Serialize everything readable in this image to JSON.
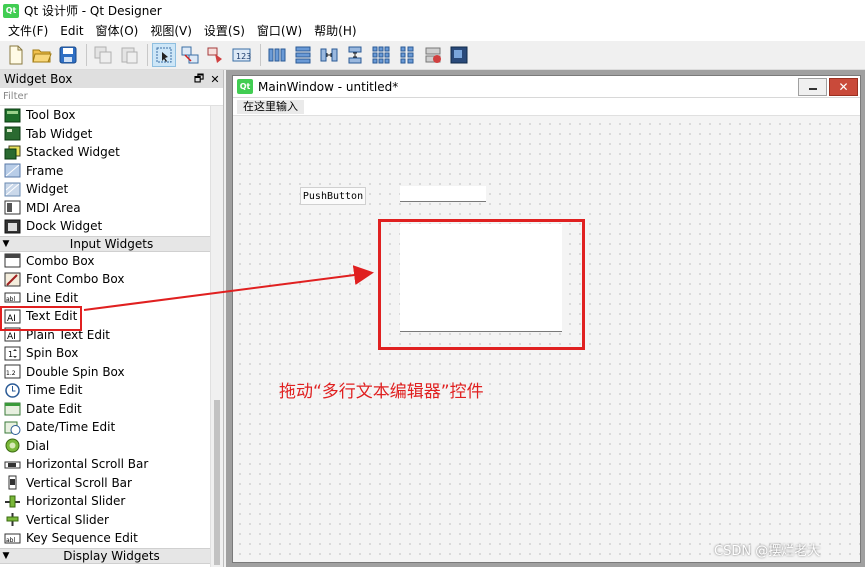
{
  "window": {
    "title": "Qt 设计师 - Qt Designer"
  },
  "menu": [
    "文件(F)",
    "Edit",
    "窗体(O)",
    "视图(V)",
    "设置(S)",
    "窗口(W)",
    "帮助(H)"
  ],
  "toolbar": [
    "new-icon",
    "open-icon",
    "save-icon",
    "copy-icon",
    "paste-icon",
    "edit-widgets-icon",
    "edit-signals-icon",
    "edit-buddies-icon",
    "edit-tab-order-icon",
    "layout-horizontal-icon",
    "layout-vertical-icon",
    "layout-splitter-h-icon",
    "layout-splitter-v-icon",
    "layout-grid-icon",
    "layout-form-icon",
    "break-layout-icon",
    "adjust-size-icon"
  ],
  "widget_box": {
    "title": "Widget Box",
    "filter_placeholder": "Filter",
    "items_top": [
      "Tool Box",
      "Tab Widget",
      "Stacked Widget",
      "Frame",
      "Widget",
      "MDI Area",
      "Dock Widget"
    ],
    "category_input": "Input Widgets",
    "items_input": [
      "Combo Box",
      "Font Combo Box",
      "Line Edit",
      "Text Edit",
      "Plain Text Edit",
      "Spin Box",
      "Double Spin Box",
      "Time Edit",
      "Date Edit",
      "Date/Time Edit",
      "Dial",
      "Horizontal Scroll Bar",
      "Vertical Scroll Bar",
      "Horizontal Slider",
      "Vertical Slider",
      "Key Sequence Edit"
    ],
    "category_display": "Display Widgets"
  },
  "form": {
    "title": "MainWindow - untitled*",
    "menu_placeholder": "在这里输入",
    "push_button": "PushButton"
  },
  "annotation": "拖动“多行文本编辑器”控件",
  "watermark": "CSDN @摆烂老大",
  "colors": {
    "highlight": "#e02020",
    "qt_green": "#41cd52"
  }
}
